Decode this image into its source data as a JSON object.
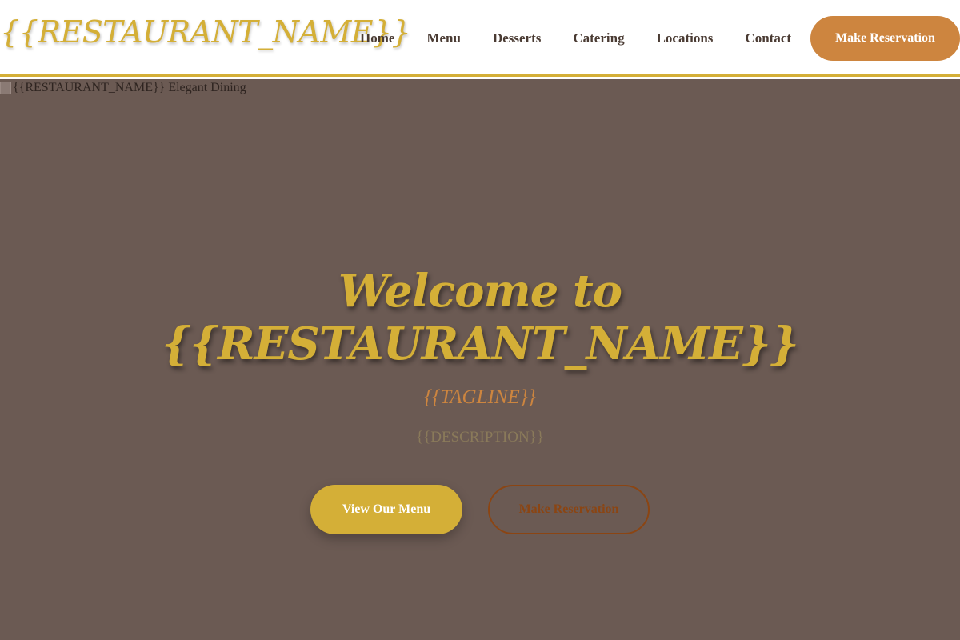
{
  "header": {
    "brand": "{{RESTAURANT_NAME}}",
    "nav": [
      {
        "label": "Home"
      },
      {
        "label": "Menu"
      },
      {
        "label": "Desserts"
      },
      {
        "label": "Catering"
      },
      {
        "label": "Locations"
      },
      {
        "label": "Contact"
      }
    ],
    "reserve_label": "Make Reservation"
  },
  "hero": {
    "image_alt": "{{RESTAURANT_NAME}} Elegant Dining",
    "title_line1": "Welcome to",
    "title_line2": "{{RESTAURANT_NAME}}",
    "tagline": "{{TAGLINE}}",
    "description": "{{DESCRIPTION}}",
    "primary_button": "View Our Menu",
    "secondary_button": "Make Reservation"
  },
  "colors": {
    "gold": "#d4af37",
    "accent_orange": "#cd853f",
    "brown": "#8b4513",
    "hero_bg": "#6b5a53",
    "nav_text": "#4a3b33"
  },
  "icons": {
    "hero_image": "broken-image-icon"
  }
}
